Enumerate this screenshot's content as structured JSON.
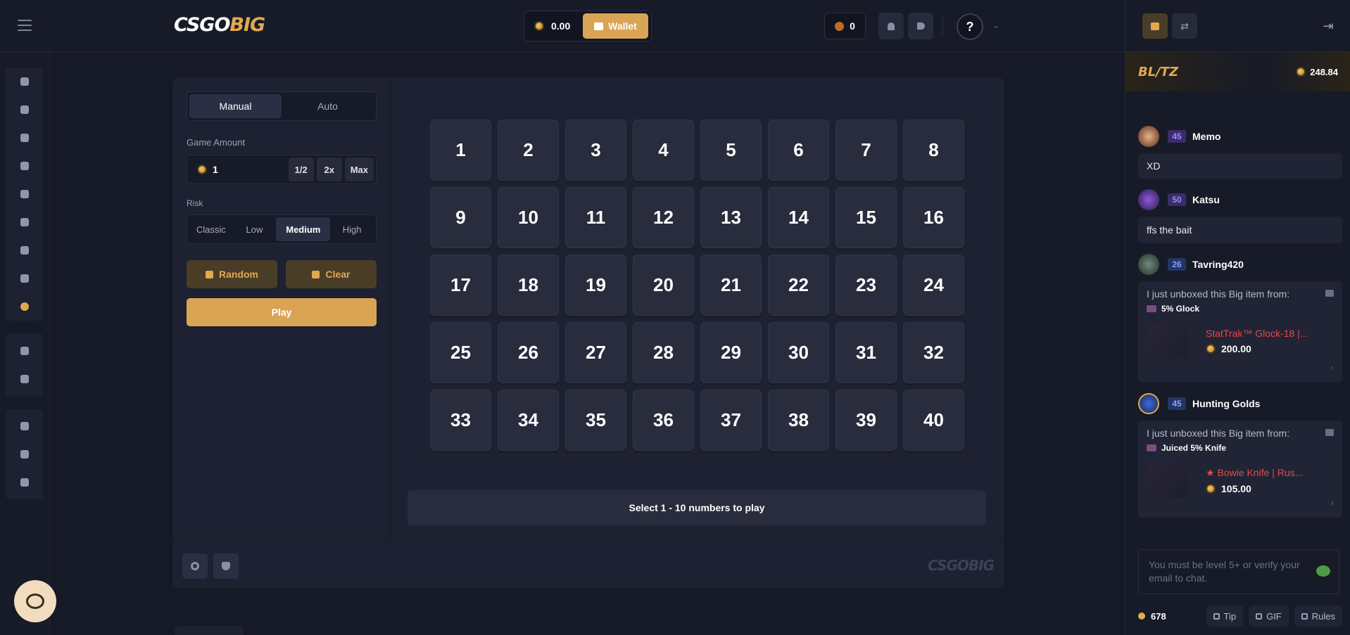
{
  "header": {
    "logo_a": "CSGO",
    "logo_b": "BIG",
    "balance": "0.00",
    "wallet_label": "Wallet",
    "points": "0",
    "help": "?",
    "chevron": "⌄"
  },
  "game": {
    "modes": [
      "Manual",
      "Auto"
    ],
    "amount_label": "Game Amount",
    "amount_value": "1",
    "quick": [
      "1/2",
      "2x",
      "Max"
    ],
    "risk_label": "Risk",
    "risks": [
      "Classic",
      "Low",
      "Medium",
      "High"
    ],
    "random_label": "Random",
    "clear_label": "Clear",
    "play_label": "Play",
    "numbers": [
      "1",
      "2",
      "3",
      "4",
      "5",
      "6",
      "7",
      "8",
      "9",
      "10",
      "11",
      "12",
      "13",
      "14",
      "15",
      "16",
      "17",
      "18",
      "19",
      "20",
      "21",
      "22",
      "23",
      "24",
      "25",
      "26",
      "27",
      "28",
      "29",
      "30",
      "31",
      "32",
      "33",
      "34",
      "35",
      "36",
      "37",
      "38",
      "39",
      "40"
    ],
    "message": "Select 1 - 10 numbers to play",
    "footer_logo": "CSGOBIG"
  },
  "chat": {
    "blitz_title": "BL/TZ",
    "blitz_amount": "248.84",
    "m1": {
      "level": "45",
      "user": "Memo",
      "text": "XD"
    },
    "m2": {
      "level": "50",
      "user": "Katsu",
      "text": "ffs the bait"
    },
    "m3": {
      "level": "26",
      "user": "Tavring420",
      "header": "I just unboxed this Big item from:",
      "box": "5% Glock",
      "item": "StatTrak™ Glock-18 |...",
      "price": "200.00"
    },
    "m4": {
      "level": "45",
      "user": "Hunting Golds",
      "header": "I just unboxed this Big item from:",
      "box": "Juiced 5% Knife",
      "item": "★ Bowie Knife | Rus...",
      "price": "105.00"
    },
    "input_placeholder": "You must be level 5+ or verify your email to chat.",
    "online": "678",
    "tip": "Tip",
    "gif": "GIF",
    "rules": "Rules"
  },
  "colors": {
    "accent": "#d9a453",
    "bg": "#161926",
    "panel": "#1d2131",
    "tile": "#282c3c",
    "item_red": "#e5484d"
  }
}
